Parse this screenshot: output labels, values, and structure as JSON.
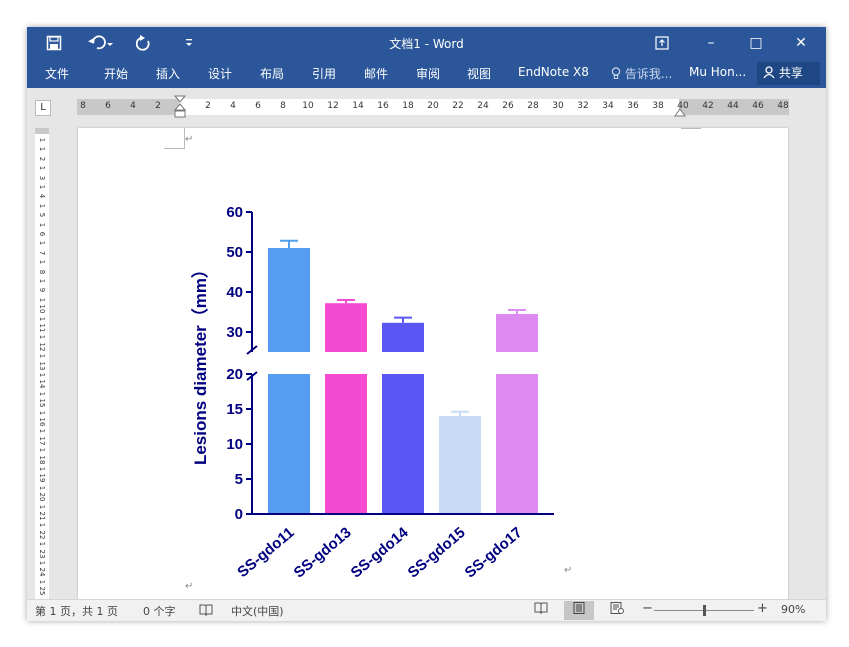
{
  "titlebar": {
    "title": "文档1 - Word",
    "save_icon": "save-icon",
    "undo_icon": "undo-icon",
    "redo_icon": "redo-icon",
    "customize_icon": "customize-qat-icon",
    "ribbon_display_icon": "ribbon-display-options-icon",
    "minimize": "–",
    "maximize": "□",
    "close": "✕"
  },
  "ribbon": {
    "tabs": [
      "文件",
      "开始",
      "插入",
      "设计",
      "布局",
      "引用",
      "邮件",
      "审阅",
      "视图",
      "EndNote X8"
    ],
    "tell_me": "告诉我...",
    "user": "Mu Hon...",
    "share": "共享"
  },
  "ruler": {
    "tab_selector": "L",
    "h_ticks": [
      "8",
      "6",
      "4",
      "2",
      "",
      "2",
      "4",
      "6",
      "8",
      "10",
      "12",
      "14",
      "16",
      "18",
      "20",
      "22",
      "24",
      "26",
      "28",
      "30",
      "32",
      "34",
      "36",
      "38",
      "40",
      "42",
      "44",
      "46",
      "48"
    ],
    "v_ticks": [
      "1",
      "1",
      "2",
      "1",
      "3",
      "1",
      "4",
      "1",
      "5",
      "1",
      "6",
      "1",
      "7",
      "1",
      "8",
      "1",
      "9",
      "1",
      "10",
      "1",
      "11",
      "1",
      "12",
      "1",
      "13",
      "1",
      "14",
      "1",
      "15",
      "1",
      "16",
      "1",
      "17",
      "1",
      "18",
      "1",
      "19",
      "1",
      "20",
      "1",
      "21",
      "1",
      "22",
      "1",
      "23",
      "1",
      "24",
      "1",
      "25"
    ]
  },
  "chart_data": {
    "type": "bar",
    "ylabel": "Lesions diameter（mm）",
    "categories": [
      "SS-gdo11",
      "SS-gdo13",
      "SS-gdo14",
      "SS-gdo15",
      "SS-gdo17"
    ],
    "values": [
      51,
      37.2,
      32.3,
      14,
      34.5
    ],
    "errors": [
      1.8,
      0.8,
      1.3,
      0.6,
      1.0
    ],
    "colors": [
      "#559df3",
      "#f54ad2",
      "#5a57f5",
      "#c8daf5",
      "#dd8bf2"
    ],
    "axis_color": "#000080",
    "axis_break": [
      20,
      25
    ],
    "ylim": [
      0,
      60
    ],
    "yticks_lower": [
      0,
      5,
      10,
      15,
      20
    ],
    "yticks_upper": [
      30,
      40,
      50,
      60
    ]
  },
  "status": {
    "page": "第 1 页，共 1 页",
    "words": "0 个字",
    "proof_icon": "proofing-icon",
    "language": "中文(中国)",
    "zoom": "90%",
    "zoom_level": 0.9
  }
}
